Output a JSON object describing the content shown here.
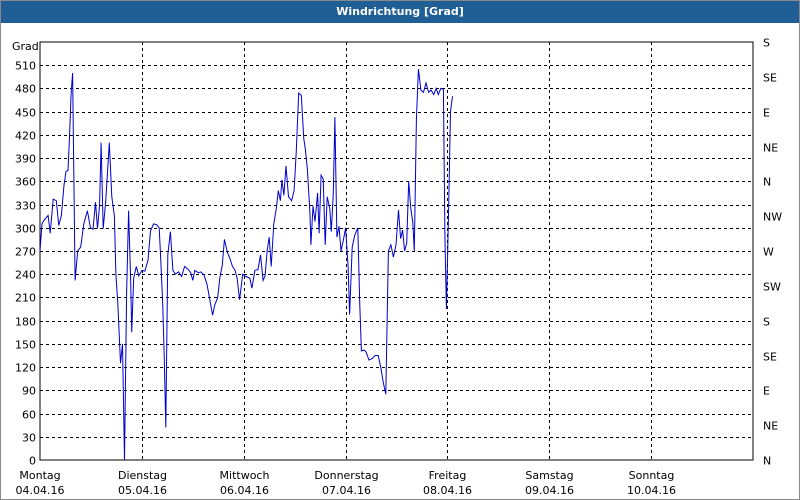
{
  "window": {
    "title": "Windrichtung [Grad]"
  },
  "chart_data": {
    "type": "line",
    "title": "Windrichtung [Grad]",
    "ylabel": "Grad",
    "ylim": [
      0,
      540
    ],
    "yticks": [
      0,
      30,
      60,
      90,
      120,
      150,
      180,
      210,
      240,
      270,
      300,
      330,
      360,
      390,
      420,
      450,
      480,
      510
    ],
    "right_axis_labels": [
      "N",
      "NE",
      "E",
      "SE",
      "S",
      "SW",
      "W",
      "NW",
      "N",
      "NE",
      "E",
      "SE",
      "S"
    ],
    "xlim": [
      0,
      7
    ],
    "day_labels": [
      {
        "day": "Montag",
        "date": "04.04.16"
      },
      {
        "day": "Dienstag",
        "date": "05.04.16"
      },
      {
        "day": "Mittwoch",
        "date": "06.04.16"
      },
      {
        "day": "Donnerstag",
        "date": "07.04.16"
      },
      {
        "day": "Freitag",
        "date": "08.04.16"
      },
      {
        "day": "Samstag",
        "date": "09.04.16"
      },
      {
        "day": "Sonntag",
        "date": "10.04.16"
      }
    ],
    "grid": true,
    "series": [
      {
        "color": "#0000cc",
        "points": [
          [
            0.0,
            270
          ],
          [
            0.02,
            305
          ],
          [
            0.04,
            310
          ],
          [
            0.08,
            316
          ],
          [
            0.1,
            293
          ],
          [
            0.13,
            337
          ],
          [
            0.16,
            335
          ],
          [
            0.185,
            303
          ],
          [
            0.21,
            316
          ],
          [
            0.235,
            354
          ],
          [
            0.255,
            373
          ],
          [
            0.275,
            374
          ],
          [
            0.29,
            417
          ],
          [
            0.305,
            473
          ],
          [
            0.32,
            500
          ],
          [
            0.345,
            232
          ],
          [
            0.37,
            270
          ],
          [
            0.4,
            275
          ],
          [
            0.43,
            305
          ],
          [
            0.465,
            322
          ],
          [
            0.495,
            300
          ],
          [
            0.52,
            298
          ],
          [
            0.545,
            333
          ],
          [
            0.565,
            299
          ],
          [
            0.585,
            330
          ],
          [
            0.6,
            410
          ],
          [
            0.62,
            299
          ],
          [
            0.645,
            334
          ],
          [
            0.68,
            410
          ],
          [
            0.705,
            340
          ],
          [
            0.73,
            315
          ],
          [
            0.745,
            240
          ],
          [
            0.765,
            200
          ],
          [
            0.79,
            125
          ],
          [
            0.81,
            150
          ],
          [
            0.83,
            0
          ],
          [
            0.85,
            215
          ],
          [
            0.87,
            322
          ],
          [
            0.89,
            230
          ],
          [
            0.9,
            165
          ],
          [
            0.92,
            235
          ],
          [
            0.945,
            250
          ],
          [
            0.97,
            238
          ],
          [
            1.0,
            245
          ],
          [
            1.03,
            244
          ],
          [
            1.06,
            258
          ],
          [
            1.085,
            296
          ],
          [
            1.115,
            305
          ],
          [
            1.145,
            304
          ],
          [
            1.17,
            300
          ],
          [
            1.185,
            260
          ],
          [
            1.205,
            202
          ],
          [
            1.22,
            130
          ],
          [
            1.235,
            42
          ],
          [
            1.255,
            265
          ],
          [
            1.28,
            295
          ],
          [
            1.305,
            245
          ],
          [
            1.33,
            240
          ],
          [
            1.36,
            243
          ],
          [
            1.39,
            237
          ],
          [
            1.42,
            250
          ],
          [
            1.45,
            247
          ],
          [
            1.48,
            242
          ],
          [
            1.5,
            232
          ],
          [
            1.52,
            245
          ],
          [
            1.555,
            242
          ],
          [
            1.58,
            243
          ],
          [
            1.61,
            239
          ],
          [
            1.64,
            227
          ],
          [
            1.67,
            205
          ],
          [
            1.695,
            187
          ],
          [
            1.715,
            200
          ],
          [
            1.745,
            210
          ],
          [
            1.765,
            235
          ],
          [
            1.79,
            252
          ],
          [
            1.81,
            285
          ],
          [
            1.84,
            268
          ],
          [
            1.865,
            260
          ],
          [
            1.89,
            250
          ],
          [
            1.915,
            245
          ],
          [
            1.935,
            235
          ],
          [
            1.96,
            207
          ],
          [
            1.99,
            240
          ],
          [
            2.02,
            237
          ],
          [
            2.06,
            235
          ],
          [
            2.08,
            222
          ],
          [
            2.11,
            245
          ],
          [
            2.14,
            246
          ],
          [
            2.165,
            265
          ],
          [
            2.19,
            232
          ],
          [
            2.21,
            238
          ],
          [
            2.23,
            270
          ],
          [
            2.25,
            288
          ],
          [
            2.27,
            250
          ],
          [
            2.295,
            305
          ],
          [
            2.32,
            325
          ],
          [
            2.34,
            348
          ],
          [
            2.36,
            335
          ],
          [
            2.375,
            362
          ],
          [
            2.395,
            342
          ],
          [
            2.415,
            380
          ],
          [
            2.44,
            340
          ],
          [
            2.47,
            335
          ],
          [
            2.495,
            348
          ],
          [
            2.515,
            397
          ],
          [
            2.54,
            474
          ],
          [
            2.565,
            471
          ],
          [
            2.59,
            415
          ],
          [
            2.605,
            402
          ],
          [
            2.625,
            375
          ],
          [
            2.65,
            320
          ],
          [
            2.66,
            278
          ],
          [
            2.68,
            328
          ],
          [
            2.7,
            308
          ],
          [
            2.725,
            345
          ],
          [
            2.74,
            293
          ],
          [
            2.76,
            368
          ],
          [
            2.78,
            363
          ],
          [
            2.8,
            278
          ],
          [
            2.82,
            340
          ],
          [
            2.845,
            325
          ],
          [
            2.86,
            295
          ],
          [
            2.88,
            345
          ],
          [
            2.895,
            443
          ],
          [
            2.915,
            288
          ],
          [
            2.935,
            302
          ],
          [
            2.955,
            270
          ],
          [
            2.98,
            285
          ],
          [
            3.0,
            300
          ],
          [
            3.025,
            250
          ],
          [
            3.04,
            188
          ],
          [
            3.065,
            275
          ],
          [
            3.09,
            290
          ],
          [
            3.12,
            300
          ],
          [
            3.14,
            200
          ],
          [
            3.155,
            141
          ],
          [
            3.18,
            142
          ],
          [
            3.2,
            140
          ],
          [
            3.23,
            129
          ],
          [
            3.26,
            131
          ],
          [
            3.29,
            135
          ],
          [
            3.32,
            135
          ],
          [
            3.345,
            120
          ],
          [
            3.37,
            100
          ],
          [
            3.395,
            85
          ],
          [
            3.42,
            270
          ],
          [
            3.445,
            278
          ],
          [
            3.47,
            262
          ],
          [
            3.495,
            278
          ],
          [
            3.52,
            323
          ],
          [
            3.54,
            286
          ],
          [
            3.56,
            297
          ],
          [
            3.58,
            270
          ],
          [
            3.6,
            280
          ],
          [
            3.62,
            360
          ],
          [
            3.64,
            325
          ],
          [
            3.66,
            307
          ],
          [
            3.675,
            270
          ],
          [
            3.695,
            440
          ],
          [
            3.715,
            505
          ],
          [
            3.74,
            478
          ],
          [
            3.765,
            475
          ],
          [
            3.79,
            487
          ],
          [
            3.815,
            475
          ],
          [
            3.84,
            478
          ],
          [
            3.865,
            472
          ],
          [
            3.89,
            480
          ],
          [
            3.91,
            472
          ],
          [
            3.935,
            480
          ],
          [
            3.96,
            479
          ],
          [
            3.975,
            290
          ],
          [
            3.99,
            195
          ],
          [
            4.01,
            310
          ],
          [
            4.03,
            450
          ],
          [
            4.05,
            470
          ]
        ]
      }
    ]
  }
}
